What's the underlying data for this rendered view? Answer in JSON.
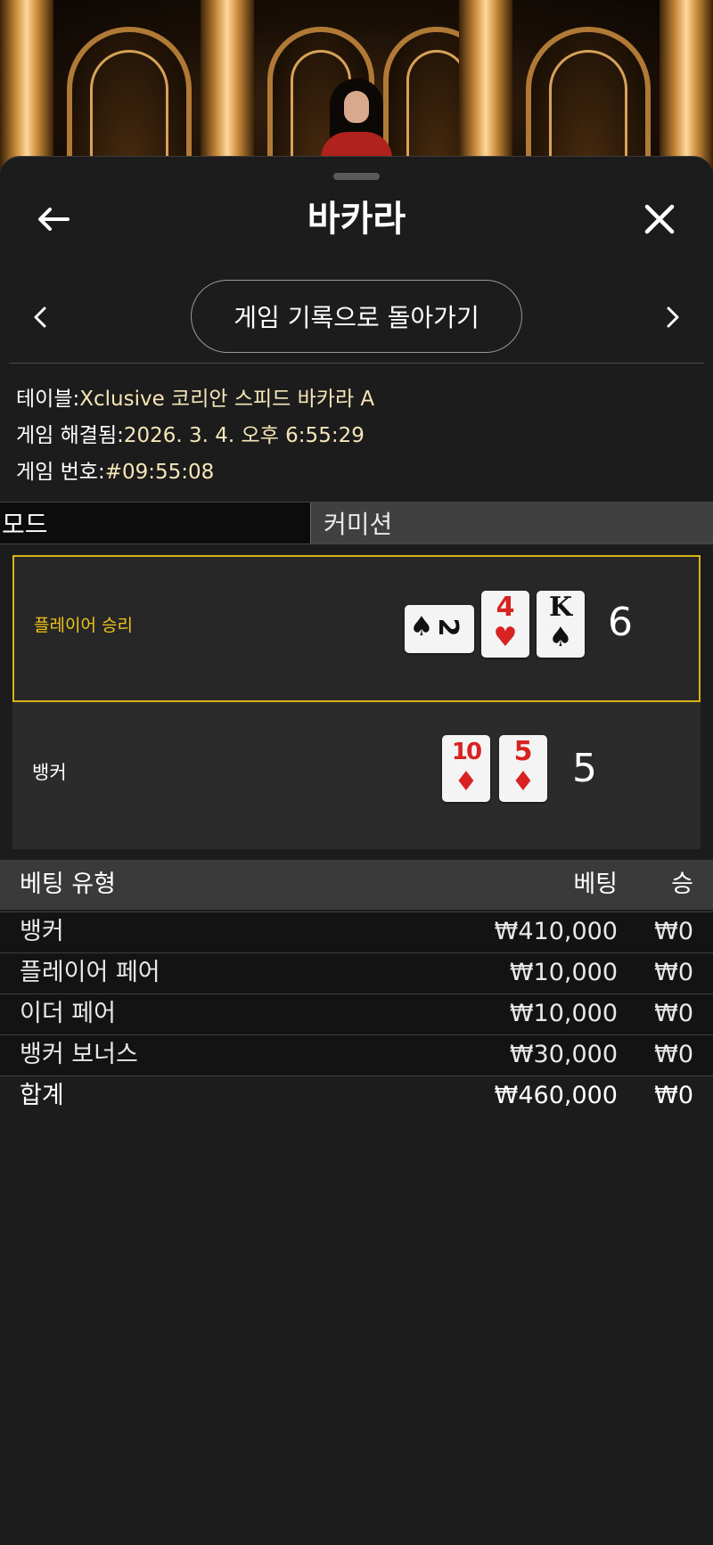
{
  "header": {
    "title": "바카라",
    "back_history_label": "게임 기록으로 돌아가기"
  },
  "info": {
    "table_label": "테이블:",
    "table_value": "Xclusive 코리안 스피드 바카라 A",
    "resolved_label": "게임 해결됨:",
    "resolved_value": "2026. 3. 4. 오후 6:55:29",
    "number_label": "게임 번호:",
    "number_value": "#09:55:08"
  },
  "modes": {
    "mode_label": "모드",
    "commission_label": "커미션"
  },
  "result": {
    "player": {
      "label": "플레이어 승리",
      "score": "6",
      "cards": [
        {
          "rank": "2",
          "suit": "♠",
          "color": "#111111",
          "rotated": true
        },
        {
          "rank": "4",
          "suit": "♥",
          "color": "#d92222",
          "rotated": false
        },
        {
          "rank": "K",
          "suit": "♠",
          "color": "#111111",
          "rotated": false
        }
      ]
    },
    "banker": {
      "label": "뱅커",
      "score": "5",
      "cards": [
        {
          "rank": "10",
          "suit": "♦",
          "color": "#d92222",
          "rotated": false
        },
        {
          "rank": "5",
          "suit": "♦",
          "color": "#d92222",
          "rotated": false
        }
      ]
    },
    "winner_highlight_color": "#d6b417"
  },
  "bets": {
    "columns": {
      "type": "베팅 유형",
      "bet": "베팅",
      "win": "승"
    },
    "rows": [
      {
        "type": "뱅커",
        "bet": "₩410,000",
        "win": "₩0"
      },
      {
        "type": "플레이어 페어",
        "bet": "₩10,000",
        "win": "₩0"
      },
      {
        "type": "이더 페어",
        "bet": "₩10,000",
        "win": "₩0"
      },
      {
        "type": "뱅커 보너스",
        "bet": "₩30,000",
        "win": "₩0"
      }
    ],
    "total": {
      "type": "합계",
      "bet": "₩460,000",
      "win": "₩0"
    }
  }
}
